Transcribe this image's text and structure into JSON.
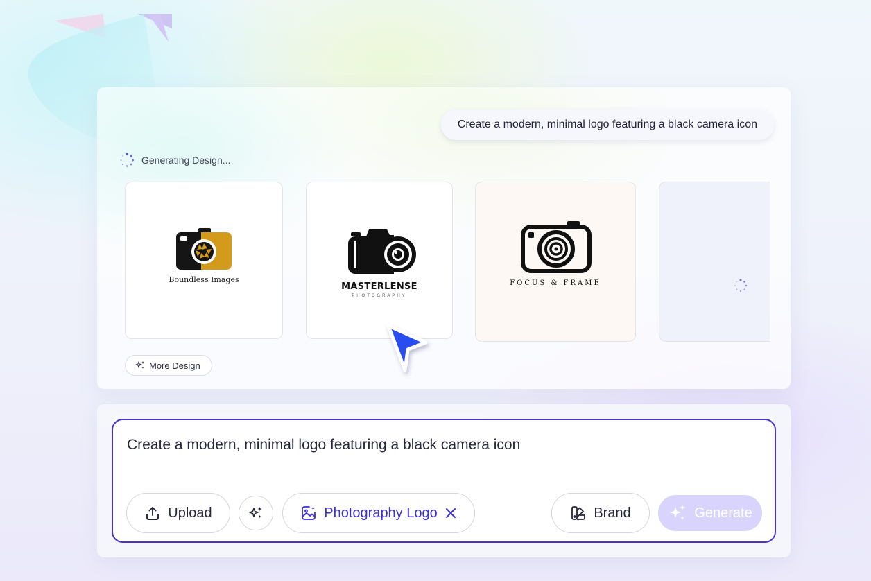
{
  "conversation": {
    "user_prompt": "Create a modern, minimal logo featuring a black camera icon"
  },
  "generation": {
    "status_text": "Generating Design...",
    "designs": [
      {
        "brand_text": "Boundless Images",
        "accent_color": "#d49a1c"
      },
      {
        "brand_text": "MASTERLENSE",
        "tagline": "PHOTOGRAPHY"
      },
      {
        "brand_text": "FOCUS & FRAME"
      },
      {
        "loading": true
      }
    ],
    "more_design_label": "More Design"
  },
  "composer": {
    "input_value": "Create a modern, minimal logo featuring a black camera icon",
    "upload_label": "Upload",
    "tag_label": "Photography Logo",
    "brand_label": "Brand",
    "generate_label": "Generate",
    "accent_color": "#4a33c8"
  }
}
